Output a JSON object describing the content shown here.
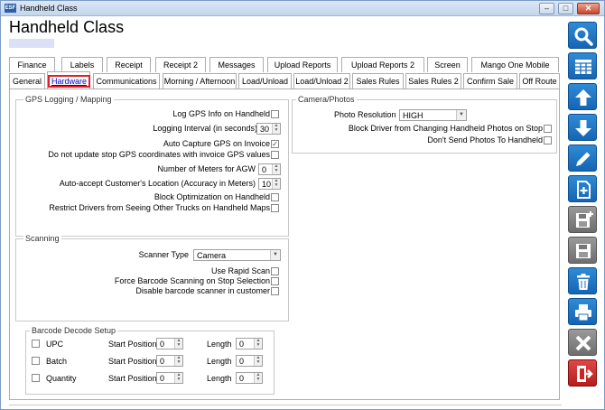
{
  "window": {
    "title": "Handheld Class",
    "app_icon_text": "ESF"
  },
  "header": {
    "title": "Handheld Class"
  },
  "tabs_row1": [
    "Finance",
    "Labels",
    "Receipt",
    "Receipt 2",
    "Messages",
    "Upload Reports",
    "Upload Reports 2",
    "Screen",
    "Mango One Mobile"
  ],
  "tabs_row2": [
    "General",
    "Hardware",
    "Communications",
    "Morning / Afternoon",
    "Load/Unload",
    "Load/Unload 2",
    "Sales Rules",
    "Sales Rules 2",
    "Confirm Sale",
    "Off Route"
  ],
  "selected_tab": "Hardware",
  "gps": {
    "legend": "GPS Logging / Mapping",
    "log_gps": {
      "label": "Log GPS Info on Handheld",
      "checked": false
    },
    "logging_interval": {
      "label": "Logging Interval (in seconds)",
      "value": "30"
    },
    "auto_capture": {
      "label": "Auto Capture GPS on Invoice",
      "checked": true
    },
    "no_update_stop": {
      "label": "Do not update stop GPS coordinates with invoice GPS values",
      "checked": false
    },
    "meters_agw": {
      "label": "Number of Meters for AGW",
      "value": "0"
    },
    "auto_accept": {
      "label": "Auto-accept Customer's Location (Accuracy in Meters)",
      "value": "10"
    },
    "block_opt": {
      "label": "Block Optimization on Handheld",
      "checked": false
    },
    "restrict_drivers": {
      "label": "Restrict Drivers from Seeing Other Trucks on Handheld Maps",
      "checked": false
    }
  },
  "camera": {
    "legend": "Camera/Photos",
    "photo_resolution": {
      "label": "Photo Resolution",
      "value": "HIGH"
    },
    "block_driver": {
      "label": "Block Driver from Changing Handheld Photos on Stop",
      "checked": false
    },
    "dont_send": {
      "label": "Don't Send Photos To Handheld",
      "checked": false
    }
  },
  "scanning": {
    "legend": "Scanning",
    "scanner_type": {
      "label": "Scanner Type",
      "value": "Camera"
    },
    "rapid_scan": {
      "label": "Use Rapid Scan",
      "checked": false
    },
    "force_barcode": {
      "label": "Force Barcode Scanning on Stop Selection",
      "checked": false
    },
    "disable_scanner": {
      "label": "Disable barcode scanner in customer",
      "checked": false
    }
  },
  "barcode": {
    "legend": "Barcode Decode Setup",
    "start_label": "Start Position",
    "length_label": "Length",
    "rows": [
      {
        "name": "UPC",
        "start": "0",
        "length": "0"
      },
      {
        "name": "Batch",
        "start": "0",
        "length": "0"
      },
      {
        "name": "Quantity",
        "start": "0",
        "length": "0"
      }
    ]
  },
  "sidebar_icons": [
    "search-icon",
    "grid-icon",
    "arrow-up-icon",
    "arrow-down-icon",
    "pencil-icon",
    "add-document-icon",
    "save-new-icon",
    "save-icon",
    "trash-icon",
    "print-icon",
    "close-icon",
    "exit-icon"
  ],
  "colors": {
    "accent_blue": "#1a73c7",
    "selected_tab_outline": "#e0202a",
    "exit_red": "#c62828"
  }
}
